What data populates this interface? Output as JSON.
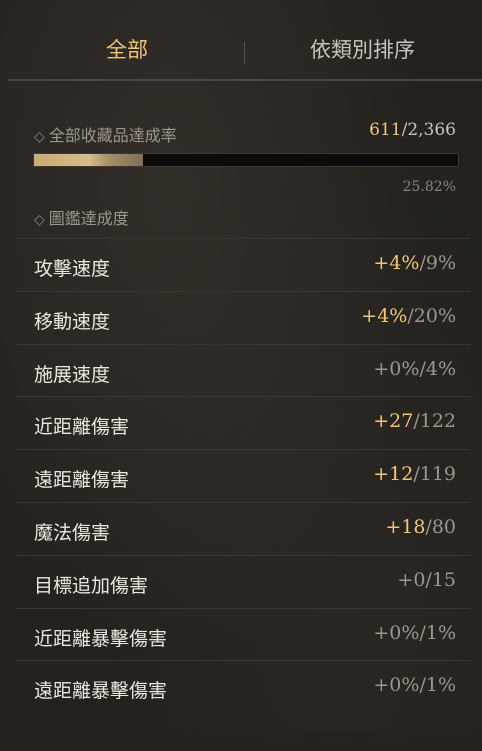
{
  "tabs": {
    "all": "全部",
    "sort": "依類別排序"
  },
  "total": {
    "label": "全部收藏品達成率",
    "current": "611",
    "max": "/2,366",
    "progress": 0.2582,
    "percent": "25.82%"
  },
  "codex": {
    "label": "圖鑑達成度"
  },
  "stats": [
    {
      "name": "攻擊速度",
      "bonus": "+4%",
      "max": "/9%",
      "gold": true
    },
    {
      "name": "移動速度",
      "bonus": "+4%",
      "max": "/20%",
      "gold": true
    },
    {
      "name": "施展速度",
      "bonus": "+0%",
      "max": "/4%",
      "gold": false
    },
    {
      "name": "近距離傷害",
      "bonus": "+27",
      "max": "/122",
      "gold": true
    },
    {
      "name": "遠距離傷害",
      "bonus": "+12",
      "max": "/119",
      "gold": true
    },
    {
      "name": "魔法傷害",
      "bonus": "+18",
      "max": "/80",
      "gold": true
    },
    {
      "name": "目標追加傷害",
      "bonus": "+0",
      "max": "/15",
      "gold": false
    },
    {
      "name": "近距離暴擊傷害",
      "bonus": "+0%",
      "max": "/1%",
      "gold": false
    },
    {
      "name": "遠距離暴擊傷害",
      "bonus": "+0%",
      "max": "/1%",
      "gold": false
    }
  ],
  "colors": {
    "accent": "#f0c77a",
    "muted": "#9d968d",
    "text": "#ece7df",
    "background": "#24211e"
  }
}
